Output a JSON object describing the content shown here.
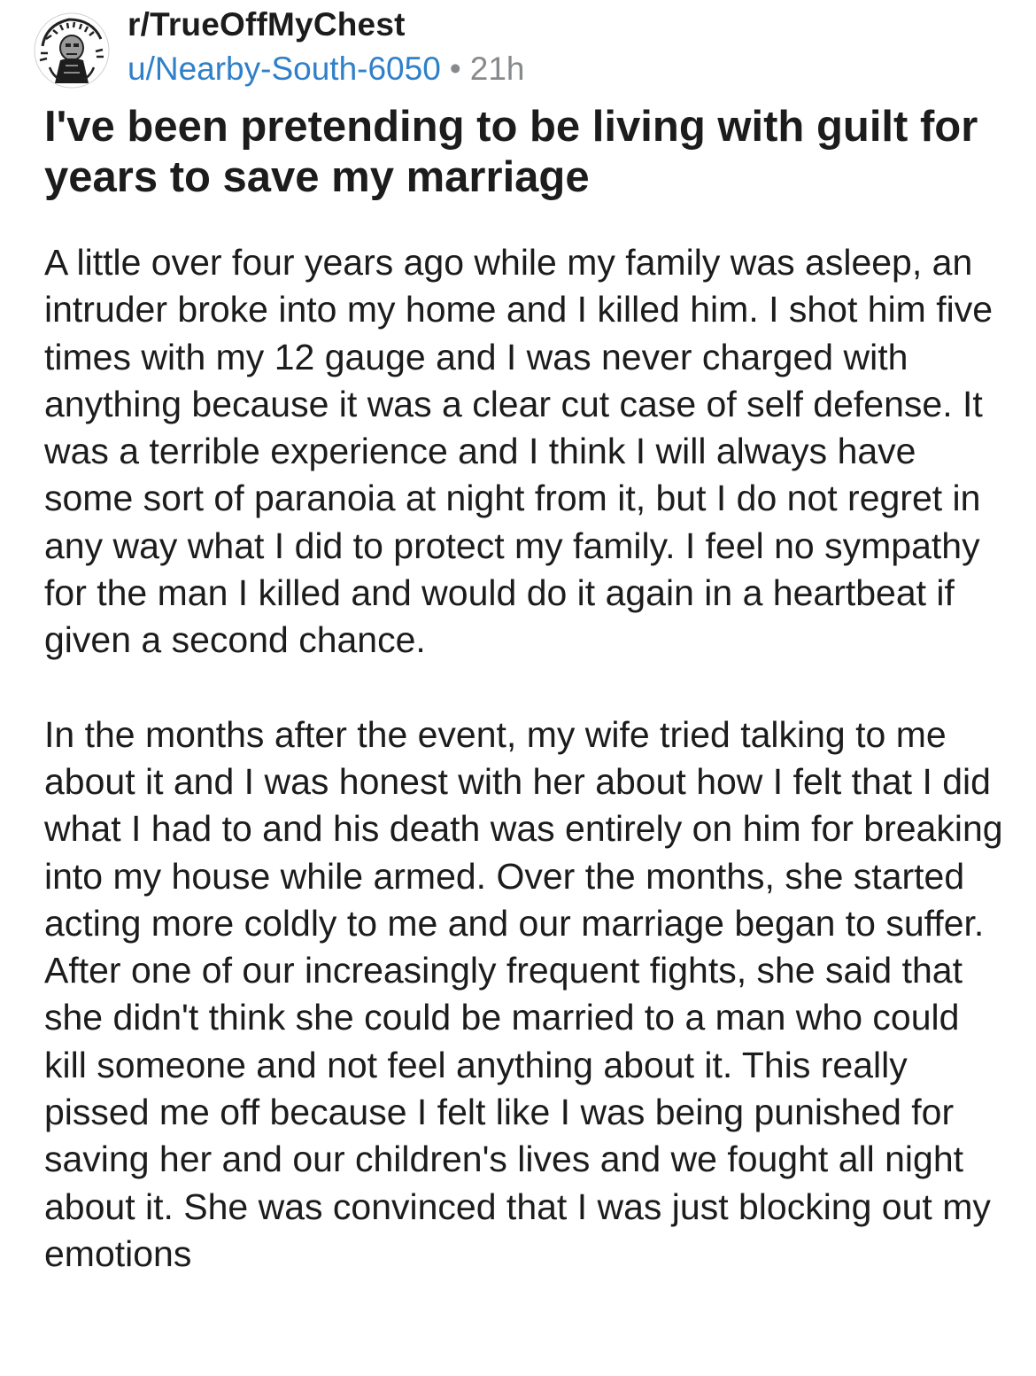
{
  "post": {
    "subreddit": "r/TrueOffMyChest",
    "author": "u/Nearby-South-6050",
    "separator": "•",
    "time_ago": "21h",
    "title": "I've been pretending to be living with guilt for years to save my marriage",
    "paragraphs": [
      "A little over four years ago while my family was asleep, an intruder broke into my home and I killed him. I shot him five times with my 12 gauge and I was never charged with anything because it was a clear cut case of self defense. It was a terrible experience and I think I will always have some sort of paranoia at night from it, but I do not regret in any way what I did to protect my family. I feel no sympathy for the man I killed and would do it again in a heartbeat if given a second chance.",
      "In the months after the event, my wife tried talking to me about it and I was honest with her about how I felt that I did what I had to and his death was entirely on him for breaking into my house while armed. Over the months, she started acting more coldly to me and our marriage began to suffer. After one of our increasingly frequent fights, she said that she didn't think she could be married to a man who could kill someone and not feel anything about it. This really pissed me off because I felt like I was being punished for saving her and our children's lives and we fought all night about it. She was convinced that I was just blocking out my emotions"
    ]
  },
  "icons": {
    "avatar": "subreddit-avatar-icon"
  },
  "colors": {
    "username": "#2f80c9",
    "muted": "#878a8c",
    "text": "#1c1c1c"
  }
}
